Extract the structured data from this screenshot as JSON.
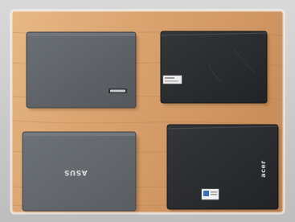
{
  "photo": {
    "subject": "four-closed-laptops-on-wooden-table",
    "colors": {
      "frame_outer": "#f4f4f4",
      "wood_light": "#e6b585",
      "wood_mid": "#d59e6a",
      "wood_dark": "#b8804d",
      "laptop_gray": "#5f6468",
      "laptop_gray_dark": "#474b4f",
      "laptop_black": "#2b2d31",
      "laptop_black_edge": "#1b1c1f",
      "logo_silver": "#d9dbdd",
      "sticker_white": "#f1f1f1"
    }
  },
  "laptops": [
    {
      "position": "top-left",
      "color_name": "gray",
      "logo_text": "",
      "has_logo_badge": true
    },
    {
      "position": "top-right",
      "color_name": "black",
      "logo_text": "",
      "has_sticker": true
    },
    {
      "position": "bottom-left",
      "color_name": "gray",
      "logo_text": "ASUS",
      "has_logo_badge": false
    },
    {
      "position": "bottom-right",
      "color_name": "black",
      "logo_text": "acer",
      "has_sticker": true
    }
  ]
}
